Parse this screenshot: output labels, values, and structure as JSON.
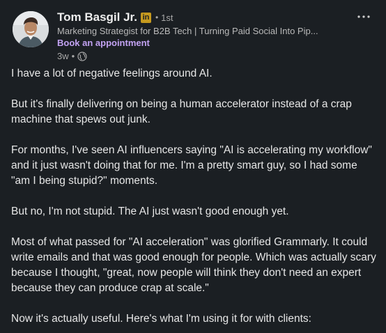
{
  "author": {
    "name": "Tom Basgil Jr.",
    "badge": "in",
    "separator": "•",
    "degree": "1st",
    "headline": "Marketing Strategist for B2B Tech | Turning Paid Social Into Pip...",
    "cta": "Book an appointment",
    "time": "3w",
    "time_separator": "•",
    "visibility_icon": "globe-icon",
    "avatar_icon": "avatar"
  },
  "menu": {
    "icon": "more-options-icon",
    "label": "···"
  },
  "post": {
    "paragraphs": [
      "I have a lot of negative feelings around AI.",
      "But it's finally delivering on being a human accelerator instead of a crap machine that spews out junk.",
      "For months, I've seen AI influencers saying \"AI is accelerating my workflow\" and it just wasn't doing that for me. I'm a pretty smart guy, so I had some \"am I being stupid?\" moments.",
      "But no, I'm not stupid. The AI just wasn't good enough yet.",
      "Most of what passed for \"AI acceleration\" was glorified Grammarly. It could write emails and that was good enough for people. Which was actually scary because I thought, \"great, now people will think they don't need an expert because they can produce crap at scale.\"",
      "Now it's actually useful. Here's what I'm using it for with clients:"
    ]
  },
  "colors": {
    "background": "#1b1f23",
    "text": "#e6e6e6",
    "secondary_text": "#a8a8a8",
    "link": "#c2a2f2",
    "badge": "#c69a1f"
  }
}
